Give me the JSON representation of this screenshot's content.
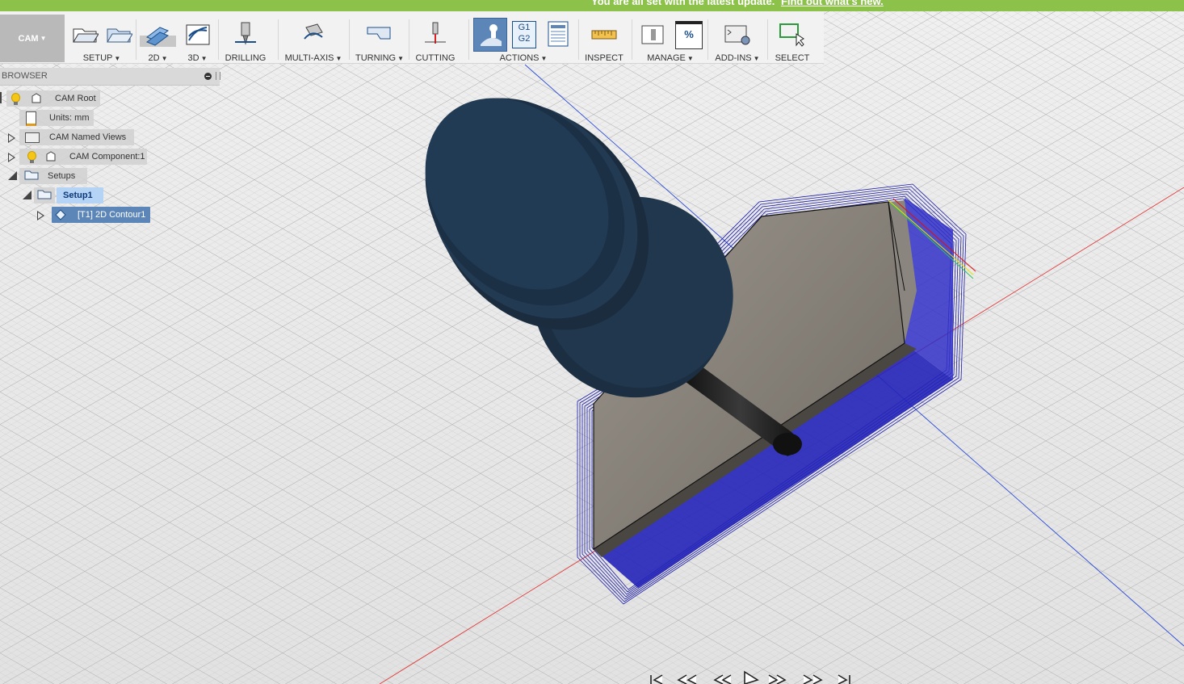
{
  "banner": {
    "message": "You are all set with the latest update.",
    "link": "Find out what's new.",
    "color": "#8cc24a"
  },
  "workspace": {
    "label": "CAM"
  },
  "toolbar": {
    "groups": [
      {
        "label": "SETUP",
        "has_menu": true
      },
      {
        "label": "2D",
        "has_menu": true,
        "active": true
      },
      {
        "label": "3D",
        "has_menu": true
      },
      {
        "label": "DRILLING",
        "has_menu": false
      },
      {
        "label": "MULTI-AXIS",
        "has_menu": true
      },
      {
        "label": "TURNING",
        "has_menu": true
      },
      {
        "label": "CUTTING",
        "has_menu": false
      },
      {
        "label": "ACTIONS",
        "has_menu": true
      },
      {
        "label": "INSPECT",
        "has_menu": false
      },
      {
        "label": "MANAGE",
        "has_menu": true
      },
      {
        "label": "ADD-INS",
        "has_menu": true
      },
      {
        "label": "SELECT",
        "has_menu": false
      }
    ],
    "actions_icon_g1g2": [
      "G1",
      "G2"
    ],
    "manage_icon_text": "%"
  },
  "browser": {
    "title": "BROWSER",
    "tree": {
      "root": "CAM Root",
      "units": "Units: mm",
      "named_views": "CAM Named Views",
      "component": "CAM Component:1",
      "setups": "Setups",
      "setup1": "Setup1",
      "operation": "[T1] 2D Contour1"
    }
  },
  "viewport": {
    "toolpath_color": "#1a1aa8",
    "tool_color": "#1c2f42",
    "axis_x_color": "#e03a3a",
    "axis_y_color": "#2b4bd6"
  }
}
